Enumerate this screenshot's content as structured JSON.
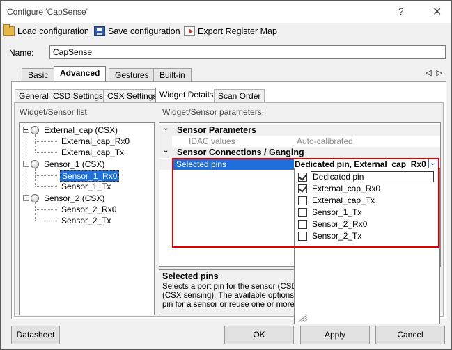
{
  "window": {
    "title": "Configure 'CapSense'",
    "help_glyph": "?",
    "close_glyph": "✕"
  },
  "toolbar": {
    "load_label": "Load configuration",
    "save_label": "Save configuration",
    "export_label": "Export Register Map",
    "icons": [
      "folder-open-icon",
      "save-icon",
      "export-icon"
    ]
  },
  "name_field": {
    "label": "Name:",
    "value": "CapSense"
  },
  "main_tabs": [
    {
      "label": "Basic",
      "active": false
    },
    {
      "label": "Advanced",
      "active": true
    },
    {
      "label": "Gestures",
      "active": false
    },
    {
      "label": "Built-in",
      "active": false
    }
  ],
  "tab_scroll": "◁ ▷",
  "sub_tabs": [
    {
      "label": "General",
      "active": false
    },
    {
      "label": "CSD Settings",
      "active": false
    },
    {
      "label": "CSX Settings",
      "active": false
    },
    {
      "label": "Widget Details",
      "active": true
    },
    {
      "label": "Scan Order",
      "active": false
    }
  ],
  "widget_list": {
    "header": "Widget/Sensor list:",
    "widgets": [
      {
        "label": "External_cap (CSX)",
        "children": [
          "External_cap_Rx0",
          "External_cap_Tx"
        ]
      },
      {
        "label": "Sensor_1 (CSX)",
        "children": [
          "Sensor_1_Rx0",
          "Sensor_1_Tx"
        ]
      },
      {
        "label": "Sensor_2 (CSX)",
        "children": [
          "Sensor_2_Rx0",
          "Sensor_2_Tx"
        ]
      }
    ],
    "selected": "Sensor_1_Rx0"
  },
  "params": {
    "header": "Widget/Sensor parameters:",
    "category_1": "Sensor Parameters",
    "idac_label": "IDAC values",
    "idac_value": "Auto-calibrated",
    "category_2": "Sensor Connections / Ganging",
    "selected_pins_label": "Selected pins",
    "selected_pins_value": "Dedicated pin, External_cap_Rx0",
    "chevron": "⌄"
  },
  "dropdown": {
    "options": [
      {
        "label": "Dedicated pin",
        "checked": true
      },
      {
        "label": "External_cap_Rx0",
        "checked": true
      },
      {
        "label": "External_cap_Tx",
        "checked": false
      },
      {
        "label": "Sensor_1_Tx",
        "checked": false
      },
      {
        "label": "Sensor_2_Rx0",
        "checked": false
      },
      {
        "label": "Sensor_2_Tx",
        "checked": false
      }
    ]
  },
  "description": {
    "title": "Selected pins",
    "line1": "Selects a port pin for the sensor (CSD s",
    "line2": "(CSX sensing). The available options ar",
    "line3": "pin for a sensor or reuse one or more pi"
  },
  "buttons": {
    "datasheet": "Datasheet",
    "ok": "OK",
    "apply": "Apply",
    "cancel": "Cancel"
  },
  "colors": {
    "selection": "#1e6fd9",
    "highlight_box": "#e00000"
  }
}
